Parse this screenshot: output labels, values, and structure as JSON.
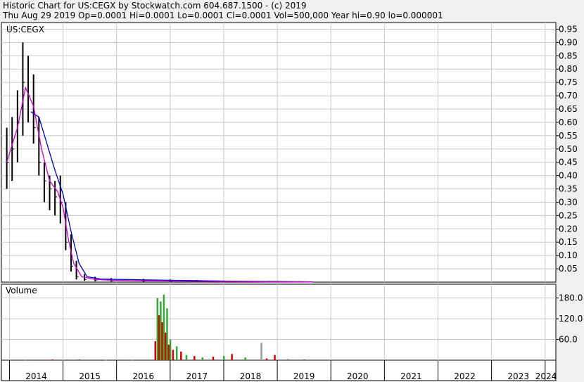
{
  "header": {
    "line1": "Historic Chart for US:CEGX by Stockwatch.com 604.687.1500 - (c) 2019",
    "line2": "Thu Aug 29 2019   Op=0.0001   Hi=0.0001   Lo=0.0001   Cl=0.0001   Vol=500,000   Year hi=0.90   lo=0.000001"
  },
  "colors": {
    "background": "#f0f0f0",
    "panel": "#ffffff",
    "grid": "#c8c8c8",
    "price_bars": "#000000",
    "ma_short": "#cc00cc",
    "ma_long": "#0000cc",
    "vol_up": "#33aa33",
    "vol_down": "#dd0000",
    "vol_neutral": "#999999"
  },
  "chart_data": {
    "type": "line",
    "symbol_label": "US:CEGX",
    "volume_label": "Volume",
    "x_ticks": [
      "2014",
      "2015",
      "2016",
      "2017",
      "2018",
      "2019",
      "2020",
      "2021",
      "2022",
      "2023",
      "2024"
    ],
    "price_axis": {
      "ylim": [
        0,
        0.975
      ],
      "ticks": [
        "0.95",
        "0.90",
        "0.85",
        "0.80",
        "0.75",
        "0.70",
        "0.65",
        "0.60",
        "0.55",
        "0.50",
        "0.45",
        "0.40",
        "0.35",
        "0.30",
        "0.25",
        "0.20",
        "0.15",
        "0.10",
        "0.05"
      ]
    },
    "volume_axis": {
      "ylim": [
        0,
        220
      ],
      "ticks": [
        "180.0",
        "120.0",
        "60.0"
      ]
    },
    "grid": true,
    "price_series": [
      {
        "x": 2013.95,
        "high": 0.58,
        "low": 0.35,
        "close": 0.45
      },
      {
        "x": 2014.05,
        "high": 0.62,
        "low": 0.38,
        "close": 0.5
      },
      {
        "x": 2014.15,
        "high": 0.72,
        "low": 0.45,
        "close": 0.6
      },
      {
        "x": 2014.25,
        "high": 0.9,
        "low": 0.55,
        "close": 0.75
      },
      {
        "x": 2014.35,
        "high": 0.85,
        "low": 0.6,
        "close": 0.7
      },
      {
        "x": 2014.45,
        "high": 0.78,
        "low": 0.52,
        "close": 0.58
      },
      {
        "x": 2014.55,
        "high": 0.62,
        "low": 0.4,
        "close": 0.45
      },
      {
        "x": 2014.65,
        "high": 0.45,
        "low": 0.3,
        "close": 0.38
      },
      {
        "x": 2014.75,
        "high": 0.4,
        "low": 0.27,
        "close": 0.35
      },
      {
        "x": 2014.85,
        "high": 0.38,
        "low": 0.25,
        "close": 0.32
      },
      {
        "x": 2014.95,
        "high": 0.4,
        "low": 0.22,
        "close": 0.3
      },
      {
        "x": 2015.05,
        "high": 0.3,
        "low": 0.12,
        "close": 0.15
      },
      {
        "x": 2015.15,
        "high": 0.18,
        "low": 0.04,
        "close": 0.06
      },
      {
        "x": 2015.25,
        "high": 0.08,
        "low": 0.01,
        "close": 0.02
      },
      {
        "x": 2015.4,
        "high": 0.03,
        "low": 0.005,
        "close": 0.01
      },
      {
        "x": 2015.6,
        "high": 0.02,
        "low": 0.003,
        "close": 0.008
      },
      {
        "x": 2015.9,
        "high": 0.015,
        "low": 0.002,
        "close": 0.005
      },
      {
        "x": 2016.5,
        "high": 0.012,
        "low": 0.001,
        "close": 0.004
      },
      {
        "x": 2017.0,
        "high": 0.01,
        "low": 0.001,
        "close": 0.003
      },
      {
        "x": 2017.5,
        "high": 0.008,
        "low": 0.0005,
        "close": 0.002
      },
      {
        "x": 2018.0,
        "high": 0.005,
        "low": 0.0002,
        "close": 0.001
      },
      {
        "x": 2018.5,
        "high": 0.003,
        "low": 0.0001,
        "close": 0.0005
      },
      {
        "x": 2019.0,
        "high": 0.002,
        "low": 0.0001,
        "close": 0.0002
      },
      {
        "x": 2019.65,
        "high": 0.0001,
        "low": 0.0001,
        "close": 0.0001
      }
    ],
    "ma_short": {
      "x": [
        2013.95,
        2014.15,
        2014.3,
        2014.45,
        2014.6,
        2014.75,
        2014.9,
        2015.0,
        2015.1,
        2015.2,
        2015.35,
        2015.6,
        2016.0,
        2017.0,
        2018.0,
        2019.0,
        2019.65
      ],
      "y": [
        0.45,
        0.58,
        0.73,
        0.66,
        0.5,
        0.38,
        0.34,
        0.28,
        0.16,
        0.07,
        0.02,
        0.01,
        0.006,
        0.004,
        0.002,
        0.001,
        0.0005
      ]
    },
    "ma_long": {
      "x": [
        2014.4,
        2014.55,
        2014.7,
        2014.85,
        2015.0,
        2015.15,
        2015.3,
        2015.45,
        2015.7,
        2016.0,
        2017.0,
        2018.0,
        2019.0,
        2019.65
      ],
      "y": [
        0.64,
        0.62,
        0.52,
        0.42,
        0.33,
        0.19,
        0.07,
        0.02,
        0.012,
        0.01,
        0.007,
        0.004,
        0.002,
        0.001
      ]
    },
    "volume_series": [
      {
        "x": 2014.3,
        "v": 1,
        "c": "down"
      },
      {
        "x": 2014.8,
        "v": 2,
        "c": "down"
      },
      {
        "x": 2015.3,
        "v": 2,
        "c": "down"
      },
      {
        "x": 2015.8,
        "v": 1,
        "c": "down"
      },
      {
        "x": 2016.3,
        "v": 1,
        "c": "down"
      },
      {
        "x": 2016.72,
        "v": 55,
        "c": "down"
      },
      {
        "x": 2016.76,
        "v": 180,
        "c": "up"
      },
      {
        "x": 2016.79,
        "v": 130,
        "c": "down"
      },
      {
        "x": 2016.82,
        "v": 170,
        "c": "up"
      },
      {
        "x": 2016.85,
        "v": 110,
        "c": "down"
      },
      {
        "x": 2016.88,
        "v": 190,
        "c": "up"
      },
      {
        "x": 2016.91,
        "v": 80,
        "c": "down"
      },
      {
        "x": 2016.94,
        "v": 150,
        "c": "up"
      },
      {
        "x": 2016.97,
        "v": 45,
        "c": "down"
      },
      {
        "x": 2017.0,
        "v": 60,
        "c": "up"
      },
      {
        "x": 2017.05,
        "v": 30,
        "c": "down"
      },
      {
        "x": 2017.12,
        "v": 40,
        "c": "up"
      },
      {
        "x": 2017.2,
        "v": 25,
        "c": "down"
      },
      {
        "x": 2017.3,
        "v": 15,
        "c": "up"
      },
      {
        "x": 2017.45,
        "v": 12,
        "c": "down"
      },
      {
        "x": 2017.6,
        "v": 8,
        "c": "up"
      },
      {
        "x": 2017.8,
        "v": 10,
        "c": "down"
      },
      {
        "x": 2018.0,
        "v": 12,
        "c": "up"
      },
      {
        "x": 2018.15,
        "v": 18,
        "c": "down"
      },
      {
        "x": 2018.4,
        "v": 8,
        "c": "up"
      },
      {
        "x": 2018.7,
        "v": 50,
        "c": "neutral"
      },
      {
        "x": 2018.8,
        "v": 5,
        "c": "down"
      },
      {
        "x": 2018.95,
        "v": 15,
        "c": "down"
      },
      {
        "x": 2019.2,
        "v": 3,
        "c": "up"
      },
      {
        "x": 2019.5,
        "v": 2,
        "c": "down"
      }
    ]
  }
}
